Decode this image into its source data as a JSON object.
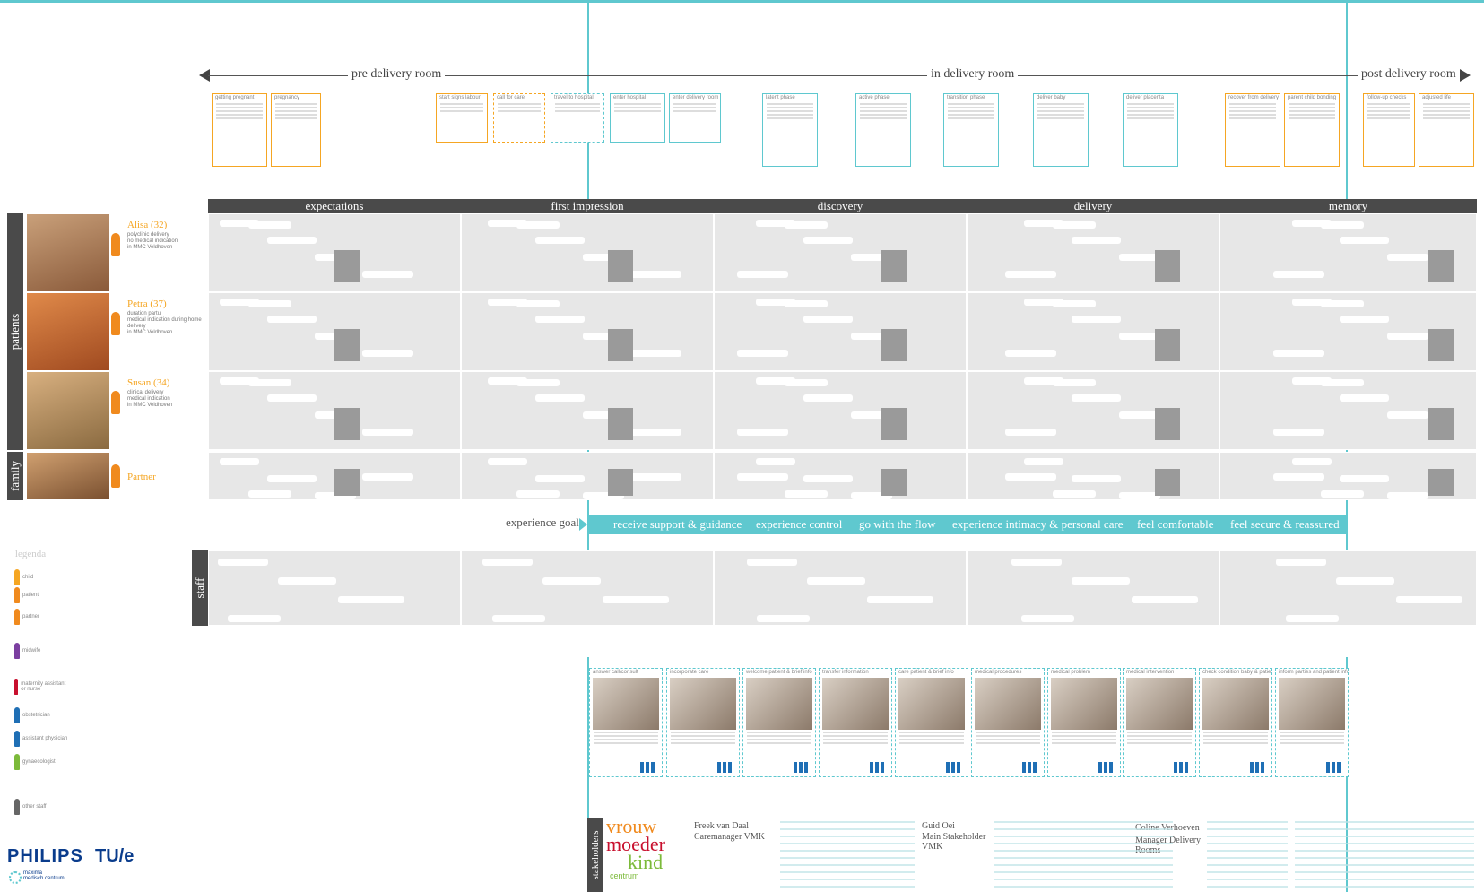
{
  "phases": {
    "pre": "pre delivery room",
    "in": "in delivery room",
    "post": "post delivery room"
  },
  "steps": [
    "getting pregnant",
    "pregnancy",
    "start signs labour",
    "call for care",
    "travel to hospital",
    "enter hospital",
    "enter delivery room",
    "latent phase",
    "active phase",
    "transition phase",
    "deliver baby",
    "deliver placenta",
    "recover from delivery",
    "parent child bonding",
    "follow-up checks",
    "adjusted life"
  ],
  "stages": [
    "expectations",
    "first impression",
    "discovery",
    "delivery",
    "memory"
  ],
  "groups": {
    "patients": "patients",
    "family": "family",
    "staff": "staff",
    "stakeholders": "stakeholders"
  },
  "persons": [
    {
      "name": "Alisa (32)",
      "desc": "polyclinic delivery\nno medical indication\nin MMC Veldhoven"
    },
    {
      "name": "Petra (37)",
      "desc": "duration partu\nmedical indication during home delivery\nin MMC Veldhoven"
    },
    {
      "name": "Susan (34)",
      "desc": "clinical delivery\nmedical indication\nin MMC Veldhoven"
    },
    {
      "name": "Partner",
      "desc": ""
    }
  ],
  "experience_goals_label": "experience goals",
  "goals": [
    "receive support & guidance",
    "experience control",
    "go with the flow",
    "experience intimacy & personal care",
    "feel comfortable",
    "feel secure & reassured"
  ],
  "legend": {
    "title": "legenda",
    "items": [
      "child",
      "patient",
      "partner",
      "midwife",
      "maternity assistant or nurse",
      "obstetrician",
      "assistant physician",
      "gynaecologist",
      "other staff"
    ]
  },
  "processes": [
    "answer call/consult",
    "incorporate care",
    "welcome patient & brief info",
    "transfer information",
    "care patient & brief info",
    "medical procedures",
    "medical problem",
    "medical intervention",
    "check condition baby & patient",
    "inform parties and patient info"
  ],
  "stakeholders": [
    {
      "name": "Freek van Daal",
      "role": "Caremanager VMK"
    },
    {
      "name": "Guid Oei",
      "role": "Main Stakeholder VMK"
    },
    {
      "name": "Coline Verhoeven",
      "role": "Manager Delivery Rooms"
    }
  ],
  "logos": {
    "vmk": [
      "vrouw",
      "moeder",
      "kind",
      "centrum"
    ],
    "philips": "PHILIPS",
    "tue": "TU/e",
    "mmc": [
      "máxima",
      "medisch centrum"
    ]
  },
  "colors": {
    "teal": "#5fc8cf",
    "orange": "#f5a623",
    "dark": "#4a4a4a",
    "light": "#e7e7e7",
    "pink": "#e0296b",
    "green": "#7cba3a",
    "purple": "#7b3fa0",
    "blue": "#1f6fb5",
    "red": "#c8102e"
  }
}
